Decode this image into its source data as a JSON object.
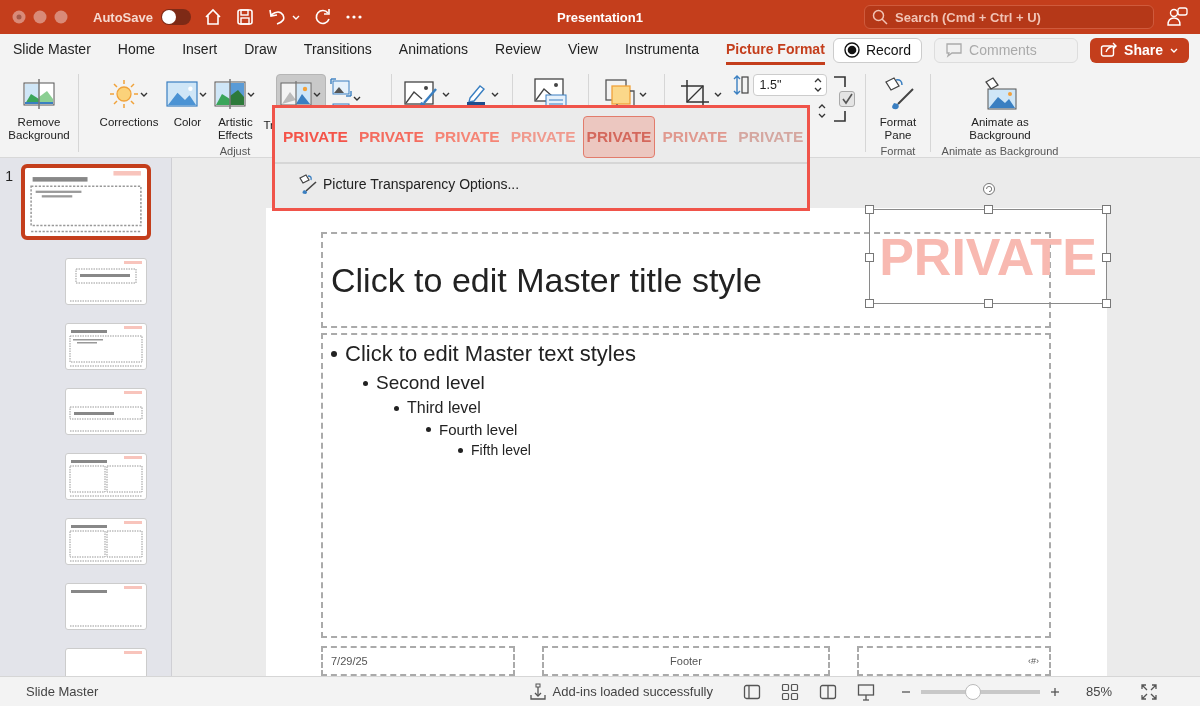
{
  "window": {
    "title": "Presentation1",
    "autosave_label": "AutoSave",
    "autosave_on": false,
    "search_placeholder": "Search (Cmd + Ctrl + U)"
  },
  "tabs": [
    {
      "label": "Slide Master",
      "selected": false
    },
    {
      "label": "Home",
      "selected": false
    },
    {
      "label": "Insert",
      "selected": false
    },
    {
      "label": "Draw",
      "selected": false
    },
    {
      "label": "Transitions",
      "selected": false
    },
    {
      "label": "Animations",
      "selected": false
    },
    {
      "label": "Review",
      "selected": false
    },
    {
      "label": "View",
      "selected": false
    },
    {
      "label": "Instrumenta",
      "selected": false
    },
    {
      "label": "Picture Format",
      "selected": true
    }
  ],
  "actions": {
    "record": "Record",
    "comments": "Comments",
    "share": "Share"
  },
  "ribbon": {
    "groups": [
      {
        "buttons": [
          {
            "kind": "background",
            "label": "Remove Background",
            "caret": false,
            "pressed": false
          }
        ]
      },
      {
        "label": "Adjust",
        "buttons": [
          {
            "kind": "sun",
            "label": "Corrections",
            "caret": true,
            "pressed": false
          },
          {
            "kind": "picture",
            "label": "Color",
            "caret": true,
            "pressed": false
          },
          {
            "kind": "artistic",
            "label": "Artistic Effects",
            "caret": true,
            "pressed": false
          },
          {
            "kind": "transparency",
            "label": "Tr",
            "caret": true,
            "pressed": true
          },
          {
            "kind": "compress",
            "caret": true,
            "pressed": false
          }
        ]
      },
      {
        "buttons": [
          {
            "kind": "style",
            "caret": true,
            "pressed": false
          },
          {
            "kind": "pen",
            "caret": true,
            "pressed": false
          }
        ]
      },
      {
        "buttons": [
          {
            "kind": "alt",
            "caret": false,
            "pressed": false
          }
        ]
      },
      {
        "buttons": [
          {
            "kind": "arrange",
            "caret": true,
            "pressed": false
          }
        ]
      },
      {
        "buttons": [
          {
            "kind": "crop",
            "caret": true,
            "pressed": false
          },
          {
            "kind": "size",
            "value": "1.5\"",
            "lock_aspect": true,
            "caret": false,
            "pressed": false
          }
        ]
      },
      {
        "label": "Format",
        "buttons": [
          {
            "kind": "format",
            "label": "Format Pane",
            "caret": false,
            "pressed": false
          }
        ]
      },
      {
        "label": "Animate as Background",
        "buttons": [
          {
            "kind": "animate",
            "label": "Animate as Background",
            "caret": false,
            "pressed": false
          }
        ]
      }
    ]
  },
  "transparency_menu": {
    "presets": [
      {
        "text": "PRIVATE",
        "color": "#f4544a",
        "selected": false
      },
      {
        "text": "PRIVATE",
        "color": "#f46c5f",
        "selected": false
      },
      {
        "text": "PRIVATE",
        "color": "#f58576",
        "selected": false
      },
      {
        "text": "PRIVATE",
        "color": "#f09a8e",
        "selected": false
      },
      {
        "text": "PRIVATE",
        "color": "#d4685c",
        "selected": true
      },
      {
        "text": "PRIVATE",
        "color": "#e0998f",
        "selected": false
      },
      {
        "text": "PRIVATE",
        "color": "#d5a7a0",
        "selected": false
      }
    ],
    "option": "Picture Transparency Options..."
  },
  "thumbnails": [
    {
      "number": "1",
      "kind": "master",
      "selected": true
    },
    {
      "kind": "titleslide",
      "selected": false
    },
    {
      "kind": "content",
      "selected": false
    },
    {
      "kind": "section",
      "selected": false
    },
    {
      "kind": "two",
      "selected": false
    },
    {
      "kind": "comparison",
      "selected": false
    },
    {
      "kind": "titleonly",
      "selected": false
    },
    {
      "kind": "blank",
      "selected": false
    }
  ],
  "slide": {
    "title": "Click to edit Master title style",
    "watermark": "PRIVATE",
    "picture_selected": true,
    "body": [
      {
        "text": "Click to edit Master text styles",
        "children": [
          {
            "text": "Second level",
            "children": [
              {
                "text": "Third level",
                "children": [
                  {
                    "text": "Fourth level",
                    "children": [
                      {
                        "text": "Fifth level"
                      }
                    ]
                  }
                ]
              }
            ]
          }
        ]
      }
    ],
    "footers": {
      "date": "7/29/25",
      "footer": "Footer",
      "number": "‹#›"
    }
  },
  "status_bar": {
    "view": "Slide Master",
    "message": "Add-ins loaded successfully",
    "zoom": {
      "level": 0.43,
      "reading": "85%"
    }
  }
}
